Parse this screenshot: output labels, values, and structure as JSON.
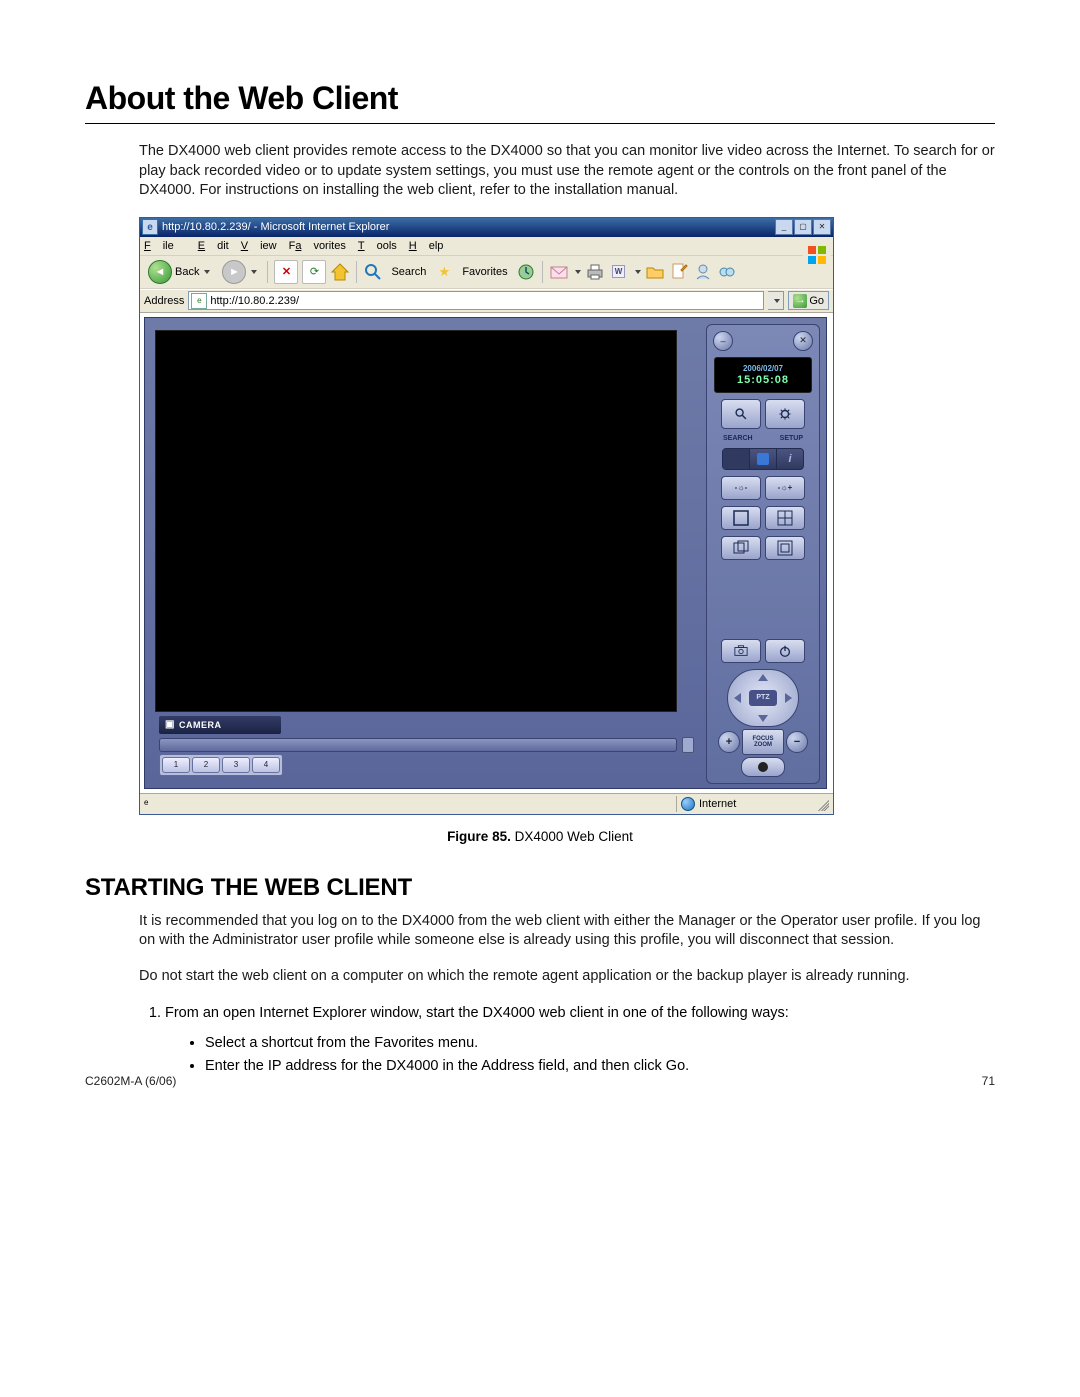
{
  "heading1": "About the Web Client",
  "intro_paragraph": "The DX4000 web client provides remote access to the DX4000 so that you can monitor live video across the Internet. To search for or play back recorded video or to update system settings, you must use the remote agent or the controls on the front panel of the DX4000. For instructions on installing the web client, refer to the installation manual.",
  "figure": {
    "label": "Figure 85.",
    "caption": "DX4000 Web Client"
  },
  "heading2": "STARTING THE WEB CLIENT",
  "para2": "It is recommended that you log on to the DX4000 from the web client with either the Manager or the Operator user profile. If you log on with the Administrator user profile while someone else is already using this profile, you will disconnect that session.",
  "para3": "Do not start the web client on a computer on which the remote agent application or the backup player is already running.",
  "step1": "From an open Internet Explorer window, start the DX4000 web client in one of the following ways:",
  "bullet1": "Select a shortcut from the Favorites menu.",
  "bullet2": "Enter the IP address for the DX4000 in the Address field, and then click Go.",
  "footer_left": "C2602M-A (6/06)",
  "footer_right": "71",
  "ie": {
    "title": "http://10.80.2.239/ - Microsoft Internet Explorer",
    "menu": {
      "file": "File",
      "edit": "Edit",
      "view": "View",
      "favorites": "Favorites",
      "tools": "Tools",
      "help": "Help"
    },
    "toolbar": {
      "back": "Back",
      "search": "Search",
      "favorites": "Favorites"
    },
    "addr_label": "Address",
    "addr_value": "http://10.80.2.239/",
    "go": "Go",
    "status_zone": "Internet"
  },
  "client": {
    "camera_label": "CAMERA",
    "cam_buttons": [
      "1",
      "2",
      "3",
      "4"
    ],
    "date": "2006/02/07",
    "time": "15:05:08",
    "btn_search": "SEARCH",
    "btn_setup": "SETUP",
    "ptz": "PTZ",
    "focus": "FOCUS",
    "zoom": "ZOOM"
  }
}
